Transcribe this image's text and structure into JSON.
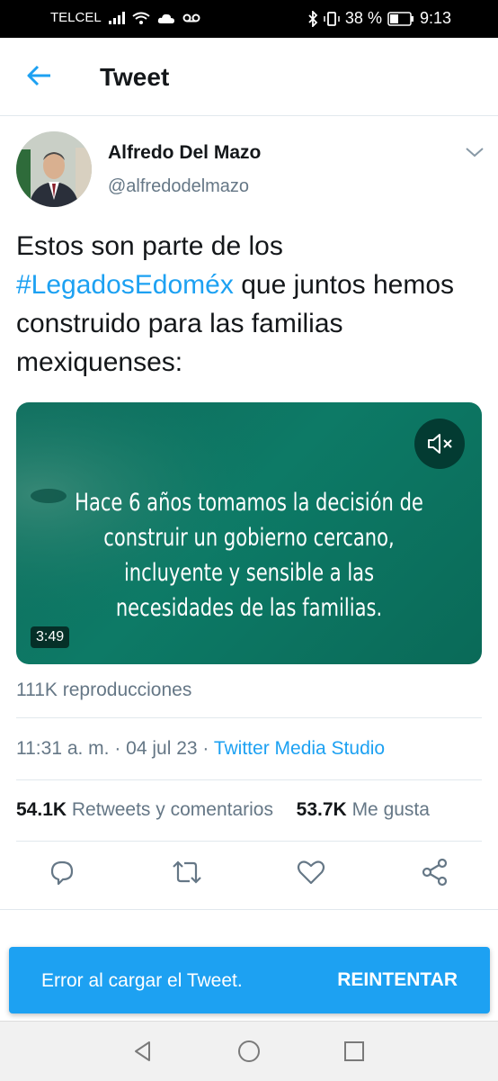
{
  "status_bar": {
    "carrier": "TELCEL",
    "battery": "38 %",
    "time": "9:13"
  },
  "header": {
    "title": "Tweet",
    "back_icon": "arrow-left-icon"
  },
  "tweet": {
    "author": {
      "name": "Alfredo Del Mazo",
      "handle": "@alfredodelmazo"
    },
    "text_before": "Estos son parte de los ",
    "hashtag": "#LegadosEdoméx",
    "text_after": " que juntos hemos construido para las familias mexiquenses:",
    "video": {
      "caption": "Hace 6 años tomamos la decisión de construir un gobierno cercano, incluyente y sensible a las necesidades de las familias.",
      "duration": "3:49"
    },
    "views": "111K reproducciones",
    "timestamp": "11:31 a. m. · 04 jul 23 · ",
    "source": "Twitter Media Studio",
    "retweets_count": "54.1K",
    "retweets_label": "Retweets y comentarios",
    "likes_count": "53.7K",
    "likes_label": "Me gusta"
  },
  "actions": [
    "reply-icon",
    "retweet-icon",
    "like-icon",
    "share-icon"
  ],
  "toast": {
    "message": "Error al cargar el Tweet.",
    "button": "REINTENTAR"
  },
  "colors": {
    "accent": "#1da1f2",
    "text": "#14171a",
    "muted": "#657786",
    "video_bg": "#0d7a66"
  }
}
